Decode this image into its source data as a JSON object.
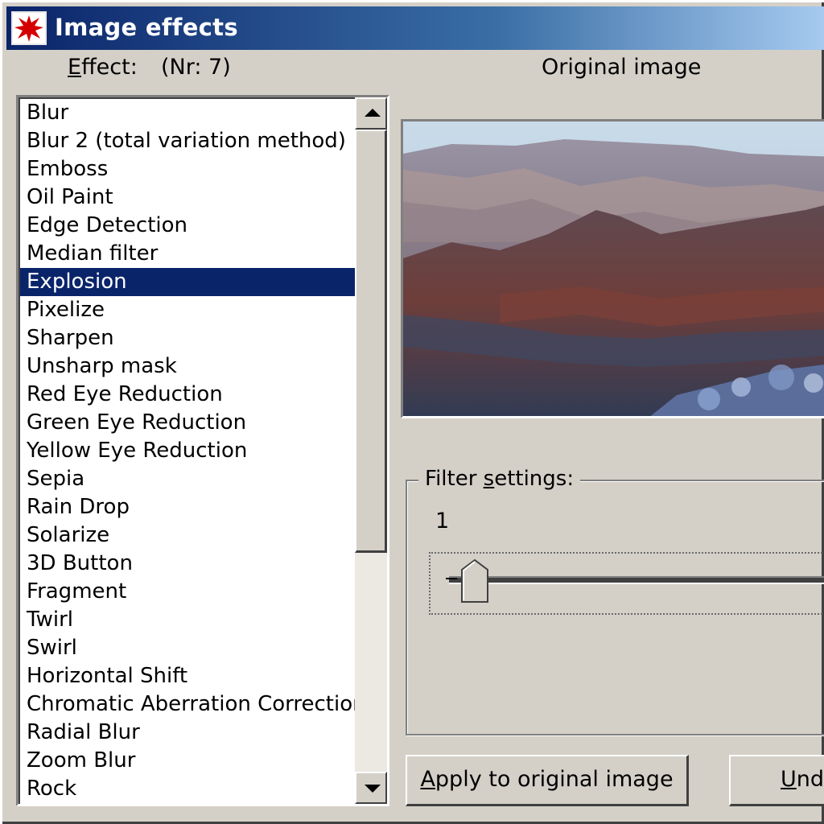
{
  "window": {
    "title": "Image effects",
    "icon": "app-splat-icon"
  },
  "effect_panel": {
    "label": "Effect:",
    "number_label": "(Nr: 7)",
    "selected_index": 6,
    "items": [
      "Blur",
      "Blur 2 (total variation method)",
      "Emboss",
      "Oil Paint",
      "Edge Detection",
      "Median filter",
      "Explosion",
      "Pixelize",
      "Sharpen",
      "Unsharp mask",
      "Red Eye Reduction",
      "Green Eye Reduction",
      "Yellow Eye Reduction",
      "Sepia",
      "Rain Drop",
      "Solarize",
      "3D Button",
      "Fragment",
      "Twirl",
      "Swirl",
      "Horizontal Shift",
      "Chromatic Aberration Correction",
      "Radial Blur",
      "Zoom Blur",
      "Rock"
    ]
  },
  "preview": {
    "label": "Original image"
  },
  "filter_settings": {
    "caption": "Filter settings:",
    "value": "1"
  },
  "buttons": {
    "apply": "Apply to original image",
    "undo": "Und"
  },
  "colors": {
    "selection": "#0a246a",
    "face": "#d4d0c8"
  }
}
